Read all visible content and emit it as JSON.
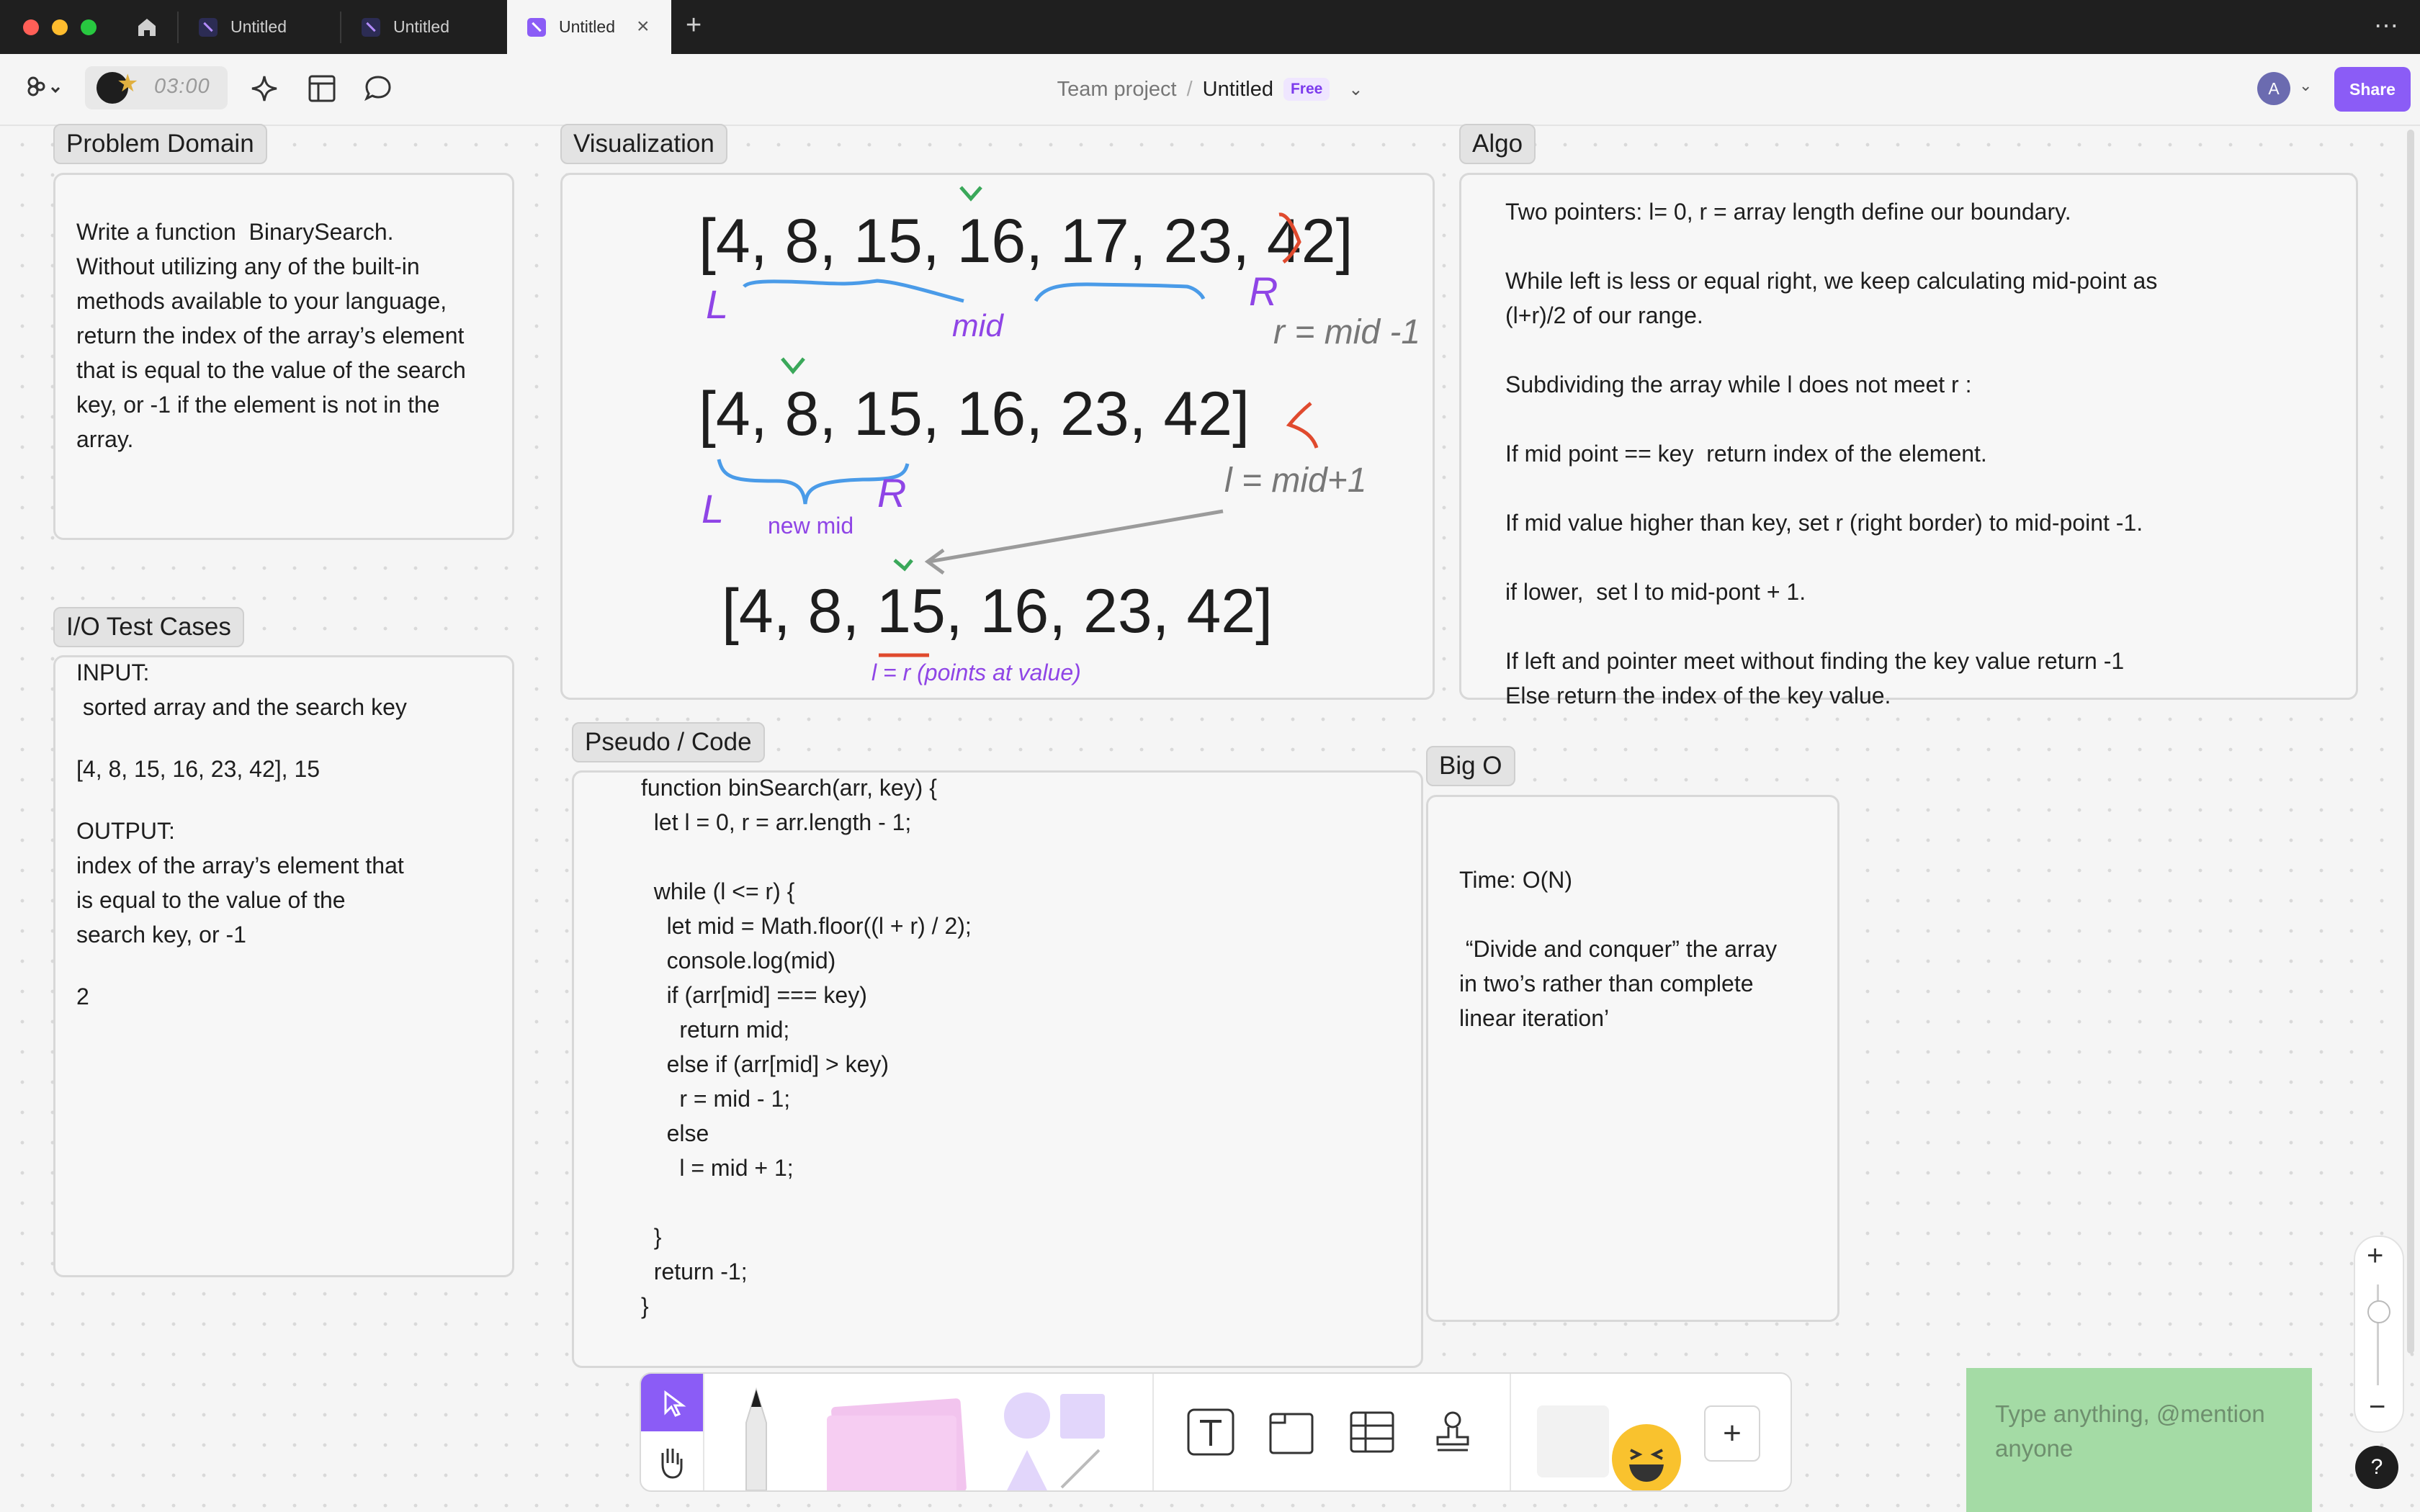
{
  "window": {
    "tabs": [
      {
        "label": "Untitled"
      },
      {
        "label": "Untitled"
      },
      {
        "label": "Untitled"
      }
    ]
  },
  "toolbar": {
    "timer": "03:00",
    "breadcrumb_team": "Team project",
    "breadcrumb_separator": "/",
    "file_name": "Untitled",
    "plan_badge": "Free",
    "avatar_initial": "A",
    "share_label": "Share"
  },
  "sections": {
    "problem": {
      "title": "Problem Domain",
      "body": "Write a function  BinarySearch.\nWithout utilizing any of the built-in\nmethods available to your language,\nreturn the index of the array’s element\nthat is equal to the value of the search\nkey, or -1 if the element is not in the\narray."
    },
    "io": {
      "title": "I/O Test Cases",
      "input_label": "INPUT:",
      "input_desc": " sorted array and the search key",
      "input_value": "[4, 8, 15, 16, 23, 42], 15",
      "output_label": "OUTPUT:",
      "output_desc": "index of the array’s element that\nis equal to the value of the\nsearch key, or -1",
      "output_value": "2"
    },
    "viz": {
      "title": "Visualization",
      "row1": "[4, 8, 15, 16, 17, 23, 42]",
      "row2": "[4, 8, 15, 16, 23, 42]",
      "row3": "[4, 8, 15, 16, 23, 42]",
      "mid": "mid",
      "new_mid": "new mid",
      "r_update": "r = mid -1",
      "l_update": "l = mid+1",
      "meet": "l = r (points at value)",
      "L": "L",
      "R": "R"
    },
    "algo": {
      "title": "Algo",
      "body": "Two pointers: l= 0, r = array length define our boundary.\n\nWhile left is less or equal right, we keep calculating mid-point as\n(l+r)/2 of our range.\n\nSubdividing the array while l does not meet r :\n\nIf mid point == key  return index of the element.\n\nIf mid value higher than key, set r (right border) to mid-point -1.\n\nif lower,  set l to mid-pont + 1.\n\nIf left and pointer meet without finding the key value return -1\nElse return the index of the key value."
    },
    "code": {
      "title": "Pseudo / Code",
      "body": "function binSearch(arr, key) {\n  let l = 0, r = arr.length - 1;\n\n  while (l <= r) {\n    let mid = Math.floor((l + r) / 2);\n    console.log(mid)\n    if (arr[mid] === key)\n      return mid;\n    else if (arr[mid] > key)\n      r = mid - 1;\n    else\n      l = mid + 1;\n\n  }\n  return -1;\n}"
    },
    "bigo": {
      "title": "Big O",
      "time": "Time: O(N)",
      "note": " “Divide and conquer” the array\nin two’s rather than complete\nlinear iteration’"
    }
  },
  "note_input": {
    "placeholder": "Type anything, @mention anyone"
  },
  "zoom": {
    "plus": "+",
    "minus": "−",
    "help": "?"
  },
  "colors": {
    "accent": "#8b5cf6",
    "blue_ink": "#4a9be8",
    "purple_ink": "#8f45e6",
    "green_ink": "#3aa85a",
    "red_ink": "#e04a2e",
    "note": "#a4dba5"
  }
}
